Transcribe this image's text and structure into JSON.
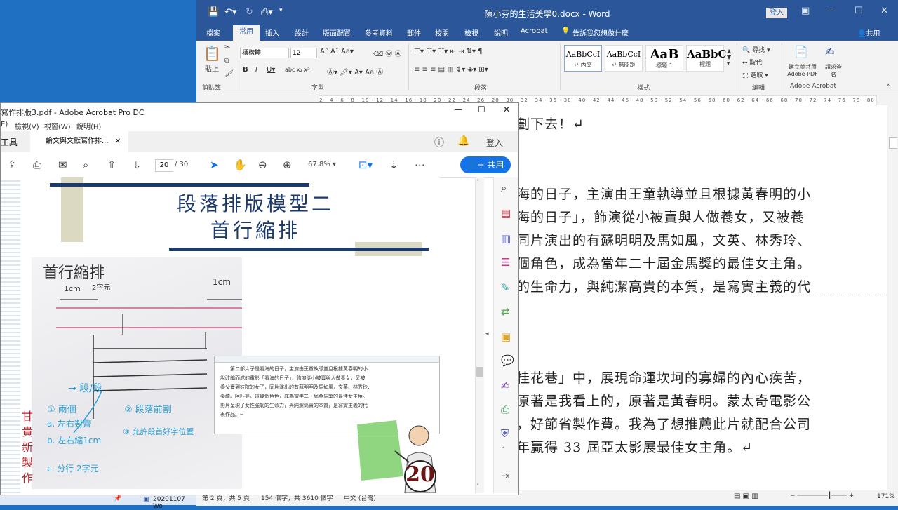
{
  "word": {
    "title": "陳小芬的生活美學0.docx - Word",
    "login": "登入",
    "tabs": [
      "檔案",
      "常用",
      "插入",
      "設計",
      "版面配置",
      "參考資料",
      "郵件",
      "校閱",
      "檢視",
      "說明",
      "Acrobat"
    ],
    "active_tab": "常用",
    "tellme": "告訴我您想做什麼",
    "share": "共用",
    "font_name": "標楷體",
    "font_size": "12",
    "paste_label": "貼上",
    "group_labels": [
      "剪貼簿",
      "字型",
      "段落",
      "樣式",
      "編輯",
      "Adobe Acrobat"
    ],
    "styles": [
      {
        "preview": "AaBbCcI",
        "name": "↵ 內文"
      },
      {
        "preview": "AaBbCcI",
        "name": "↵ 無間距"
      },
      {
        "preview": "AaB",
        "name": "標題 1"
      },
      {
        "preview": "AaBbC",
        "name": "標題"
      }
    ],
    "edit_items": [
      "尋找 ▾",
      "取代",
      "選取 ▾"
    ],
    "acrobat_items": [
      "建立並共用 Adobe PDF",
      "請求簽名"
    ],
    "ruler_text": "2 · 4 · 6 · 8 · 10 · 12 · 14 · 16 · 18 · 20 · 22 · 24 · 26 · 28 · 30 · 32 · 34 · 36 · 38 · 40 · 42 · 44 · 46 · 48 · 50 · 52 · 54 · 56 · 58 · 60 · 62 · 64 · 66 · 68 · 70 · 72 · 74 · 76 · 78 · 80",
    "doc_lines": [
      "劃下去！↵",
      "海的日子，主演由王童執導並且根據黃春明的小",
      "海的日子」，飾演從小被賣與人做養女，又被養",
      "同片演出的有蘇明明及馬如風，文英、林秀玲、",
      "個角色，成為當年二十屆金馬獎的最佳女主角。",
      "的生命力，與純潔高貴的本質，是寫實主義的代",
      "桂花巷」中，展現命運坎坷的寡婦的內心疾苦，",
      "原著是我看上的，原著是黃春明。蒙太奇電影公",
      "，好節省製作費。我為了想推薦此片就配合公司",
      "年贏得 33 屆亞太影展最佳女主角。↵"
    ],
    "status": {
      "page": "第 2 頁，共 5 頁",
      "words": "154 個字，共 3610 個字",
      "lang": "中文 (台灣)",
      "zoom": "171%"
    }
  },
  "acrobat": {
    "title": "寫作排版3.pdf - Adobe Acrobat Pro DC",
    "menu": [
      "E)",
      "檢視(V)",
      "視窗(W)",
      "說明(H)"
    ],
    "tools_tab": "工具",
    "doc_tab": "論文與文獻寫作排...",
    "login": "登入",
    "page_current": "20",
    "page_total": "/ 30",
    "zoom": "67.8%",
    "share": "共用",
    "slide": {
      "title1": "段落排版模型二",
      "title2": "首行縮排",
      "hand_title": "首行縮排",
      "hand_measure1": "1cm",
      "hand_measure2": "2字元",
      "hand_measure3": "1cm",
      "hand_side": "甘貴新製作",
      "hand_notes": [
        "→ 段/段",
        "① 兩個",
        "② 段落前割",
        "a. 左右對齊",
        "b. 左右縮1cm",
        "c. 分行 2字元",
        "③ 允許段首好字位置"
      ],
      "snippet_lines": [
        "第二部片子是看海的日子，主演由王童執導並且根據黃春明的小",
        "說改編而成的電影「看海的日子」，飾演從小被賣與人做養女，又被",
        "養父賣到妓院的女子，同片演出的有蘇明明及馬如風，文英、林秀玲、",
        "秦綺、阿匹婆，這幾個角色，成為當年二十屆金馬獎的最佳女主角。",
        "影片呈現了女性強韌的生命力，與純潔高貴的本質，是寫實主義的代",
        "表作品。↵"
      ],
      "page_number": "20"
    }
  },
  "taskbar": {
    "item": "20201107 Wo"
  },
  "colors": {
    "word_blue": "#2b579a",
    "acro_blue": "#1473e6",
    "slide_navy": "#1c3a6e"
  }
}
